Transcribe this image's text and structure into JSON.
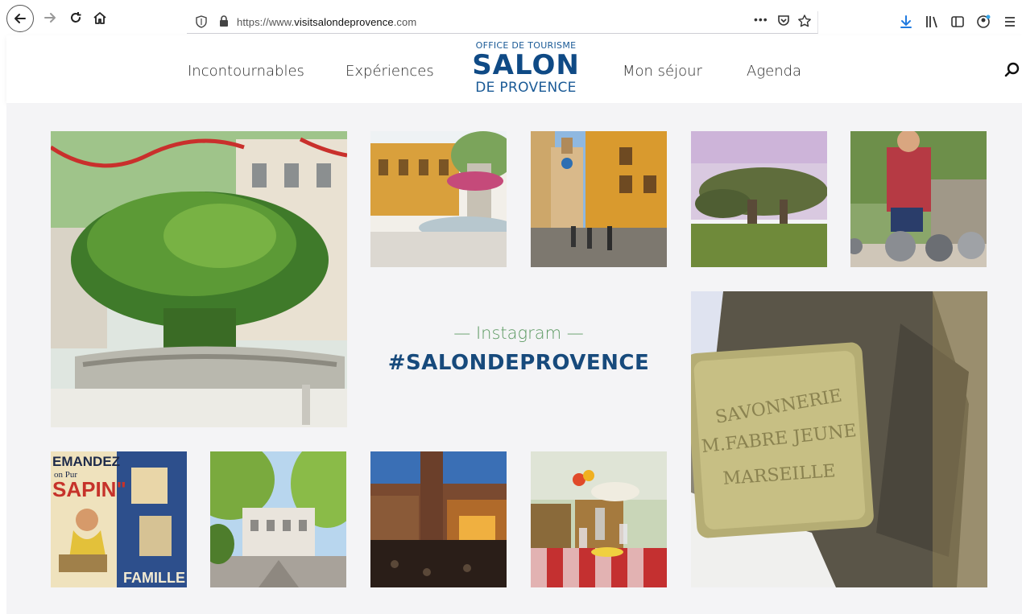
{
  "browser": {
    "url_prefix": "https://www.",
    "url_domain": "visitsalondeprovence",
    "url_suffix": ".com",
    "overflow_label": "•••"
  },
  "nav": {
    "items": [
      "Incontournables",
      "Expériences",
      "Mon séjour",
      "Agenda"
    ]
  },
  "logo": {
    "top": "OFFICE DE TOURISME",
    "main": "SALON",
    "bottom": "DE PROVENCE"
  },
  "instagram": {
    "label": "— Instagram —",
    "hashtag": "#SALONDEPROVENCE"
  },
  "soap": {
    "line1": "SAVONNERIE",
    "line2": "M.FABRE JEUNE",
    "line3": "MARSEILLE"
  },
  "poster": {
    "line1": "EMANDEZ",
    "line2": "on Pur",
    "line3": "SAPIN\"",
    "line4": "FAMILLE"
  },
  "colors": {
    "accent_green": "#5d9a63",
    "brand_blue": "#174a7c"
  }
}
